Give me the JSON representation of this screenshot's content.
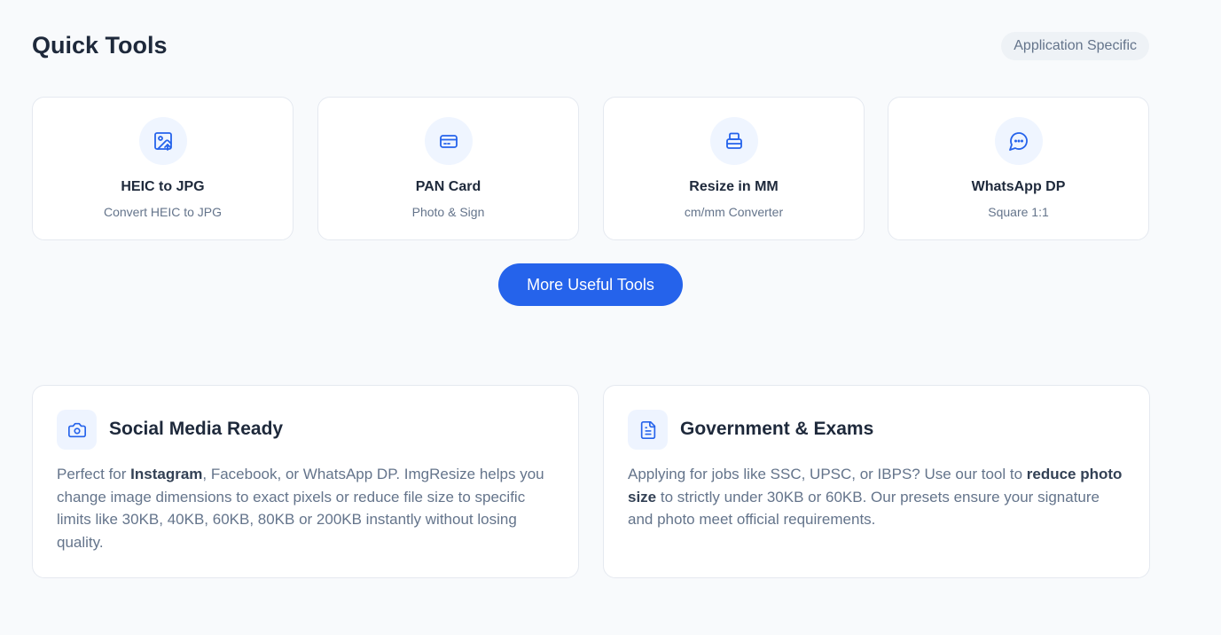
{
  "header": {
    "title": "Quick Tools",
    "badge": "Application Specific"
  },
  "tools": [
    {
      "icon": "image-upload-icon",
      "title": "HEIC to JPG",
      "subtitle": "Convert HEIC to JPG"
    },
    {
      "icon": "id-card-icon",
      "title": "PAN Card",
      "subtitle": "Photo & Sign"
    },
    {
      "icon": "ruler-stack-icon",
      "title": "Resize in MM",
      "subtitle": "cm/mm Converter"
    },
    {
      "icon": "chat-bubble-icon",
      "title": "WhatsApp DP",
      "subtitle": "Square 1:1"
    }
  ],
  "more_button": "More Useful Tools",
  "info_cards": [
    {
      "icon": "camera-icon",
      "title": "Social Media Ready",
      "text": [
        {
          "t": "Perfect for ",
          "b": false
        },
        {
          "t": "Instagram",
          "b": true
        },
        {
          "t": ", Facebook, or WhatsApp DP. ImgResize helps you change image dimensions to exact pixels or reduce file size to specific limits like 30KB, 40KB, 60KB, 80KB or 200KB instantly without losing quality.",
          "b": false
        }
      ]
    },
    {
      "icon": "document-icon",
      "title": "Government & Exams",
      "text": [
        {
          "t": "Applying for jobs like SSC, UPSC, or IBPS? Use our tool to ",
          "b": false
        },
        {
          "t": "reduce photo size",
          "b": true
        },
        {
          "t": " to strictly under 30KB or 60KB. Our presets ensure your signature and photo meet official requirements.",
          "b": false
        }
      ]
    }
  ],
  "colors": {
    "accent": "#2563eb",
    "background": "#f8fafc",
    "card": "#ffffff",
    "muted_text": "#64748b"
  }
}
